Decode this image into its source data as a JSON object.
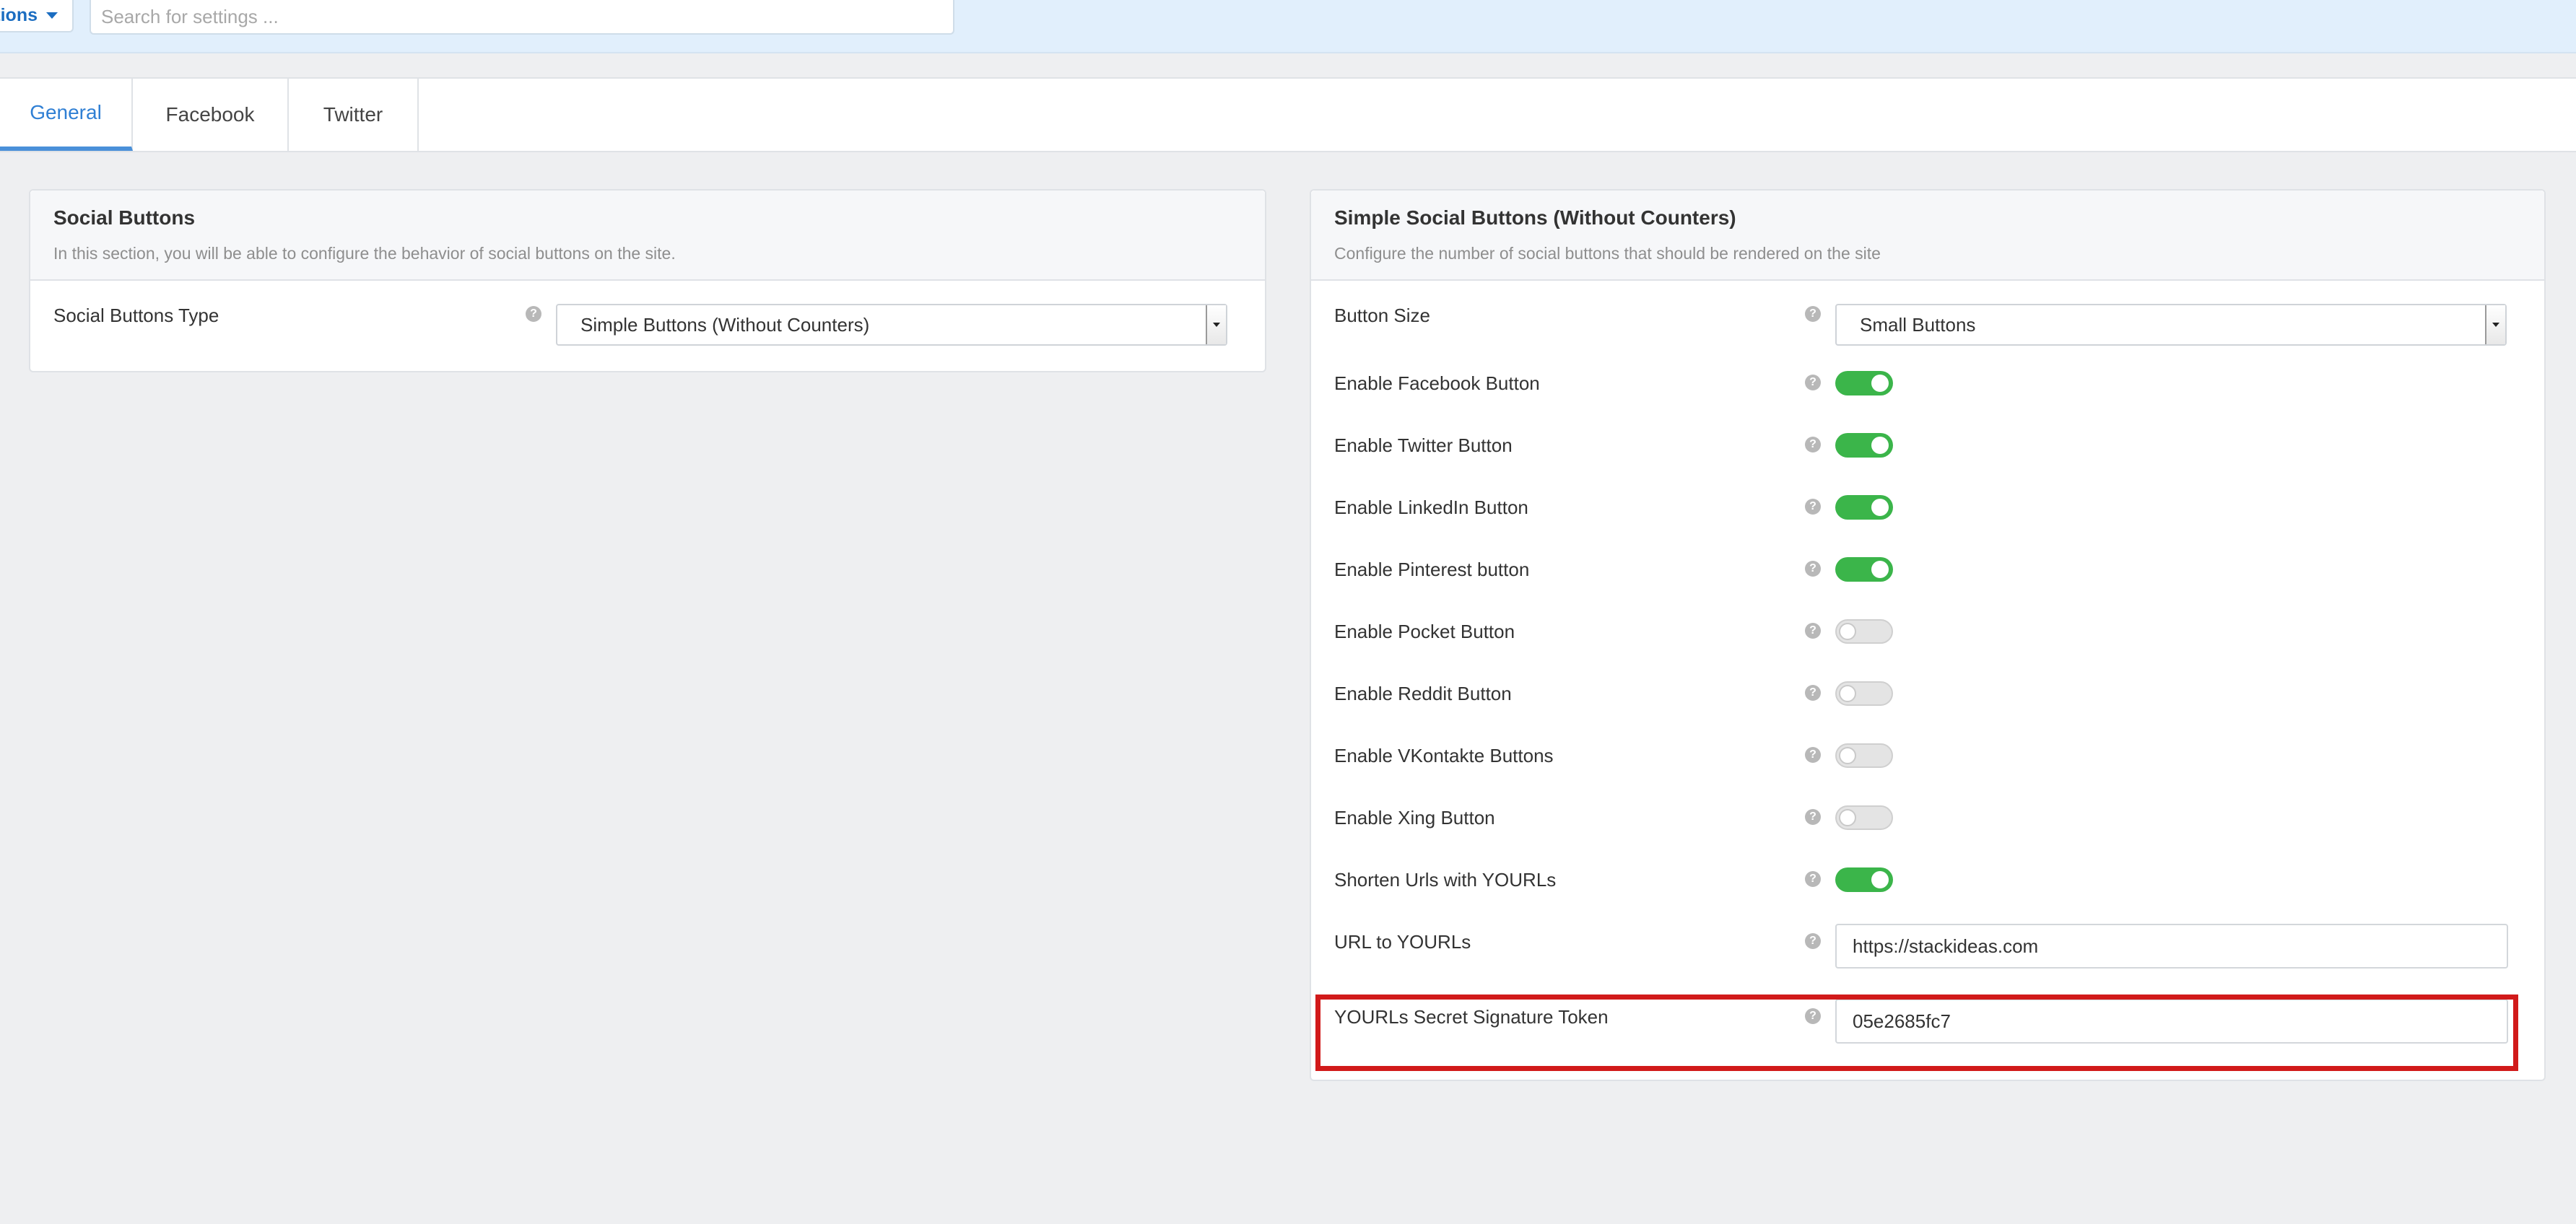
{
  "topbar": {
    "actions_label": "tions",
    "search_placeholder": "Search for settings ..."
  },
  "tabs": [
    {
      "label": "General",
      "active": true
    },
    {
      "label": "Facebook",
      "active": false
    },
    {
      "label": "Twitter",
      "active": false
    }
  ],
  "left_panel": {
    "title": "Social Buttons",
    "description": "In this section, you will be able to configure the behavior of social buttons on the site.",
    "rows": [
      {
        "label": "Social Buttons Type",
        "type": "select",
        "value": "Simple Buttons (Without Counters)"
      }
    ]
  },
  "right_panel": {
    "title": "Simple Social Buttons (Without Counters)",
    "description": "Configure the number of social buttons that should be rendered on the site",
    "button_size": {
      "label": "Button Size",
      "value": "Small Buttons"
    },
    "toggles": [
      {
        "label": "Enable Facebook Button",
        "on": true
      },
      {
        "label": "Enable Twitter Button",
        "on": true
      },
      {
        "label": "Enable LinkedIn Button",
        "on": true
      },
      {
        "label": "Enable Pinterest button",
        "on": true
      },
      {
        "label": "Enable Pocket Button",
        "on": false
      },
      {
        "label": "Enable Reddit Button",
        "on": false
      },
      {
        "label": "Enable VKontakte Buttons",
        "on": false
      },
      {
        "label": "Enable Xing Button",
        "on": false
      },
      {
        "label": "Shorten Urls with YOURLs",
        "on": true
      }
    ],
    "url_field": {
      "label": "URL to YOURLs",
      "value": "https://stackideas.com"
    },
    "token_field": {
      "label": "YOURLs Secret Signature Token",
      "value": "05e2685fc7"
    }
  },
  "icons": {
    "help": "question-circle-icon",
    "dropdown": "caret-down-icon"
  },
  "colors": {
    "accent": "#2f7fd4",
    "toggle_on": "#3bb54a",
    "highlight": "#d11a1a"
  }
}
